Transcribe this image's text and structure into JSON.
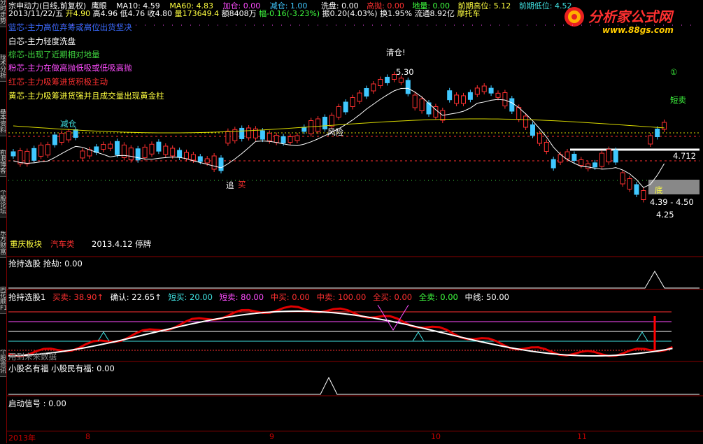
{
  "header": {
    "stock_name": "宗申动力(日线,前复权)",
    "indicator_name": "鹰眼",
    "ma10": "MA10: 4.59",
    "ma60": "MA60: 4.83",
    "jiacang": "加仓: 0.00",
    "jiancang": "减仓: 1.00",
    "xipan": "洗盘: 0.00",
    "gaopao": "高抛: 0.00",
    "diliang": "地量: 0.00",
    "prev_high": "前期高位: 5.12",
    "prev_low": "前期低位: 4.52",
    "date": "2013/11/22/五",
    "open": "开4.90",
    "high": "高4.96",
    "low": "低4.76",
    "close": "收4.80",
    "volume": "量173649.4",
    "amount": "额8408万",
    "change": "幅-0.16(-3.23%)",
    "amplitude": "振0.20(4.03%)",
    "turnover": "换1.95%",
    "float_shares": "流通8.92亿",
    "sector": "摩托车"
  },
  "left_tabs": [
    "分时走势",
    "技术分析",
    "基本资料",
    "新浪博客",
    "个股论坛",
    "东方财富",
    "同花顺F10",
    "个股资讯"
  ],
  "legend": [
    {
      "text": "蓝芯-主力高位弃筹或高位出货坚决",
      "color": "#3a6bff"
    },
    {
      "text": "白芯-主力轻度洗盘",
      "color": "#ffffff"
    },
    {
      "text": "棕芯-出现了近期相对地量",
      "color": "#3fd63f"
    },
    {
      "text": "粉芯-主力在做高抛低吸或低吸高抛",
      "color": "#ff4dff"
    },
    {
      "text": "红芯-主力吸筹进货积极主动",
      "color": "#ff3030"
    },
    {
      "text": "黄芯-主力吸筹进货强并且成交量出现黄金柱",
      "color": "#ffff40"
    }
  ],
  "annotations": {
    "qingcang": "清仓!",
    "peak_price": "5.30",
    "circle1": "①",
    "duanmai": "短卖",
    "jiancang_lbl": "减仓",
    "fengxian": "风险",
    "zhui": "追",
    "mai": "买",
    "level": "4.712",
    "di": "底",
    "range": "4.39 - 4.50",
    "bottom_price": "4.25",
    "sector_block": "重庆板块",
    "sector_cat": "汽车类",
    "suspend": "2013.4.12 停牌"
  },
  "panels": {
    "p2_title": "抢持选股 抢劫: 0.00",
    "p3_title": "抢持选股1",
    "p3_values": [
      {
        "text": "买卖: 38.90↑",
        "color": "#ff3030"
      },
      {
        "text": "确认: 22.65↑",
        "color": "#ffffff"
      },
      {
        "text": "短买: 20.00",
        "color": "#40e0e0"
      },
      {
        "text": "短卖: 80.00",
        "color": "#ff4dff"
      },
      {
        "text": "中买: 0.00",
        "color": "#ff3030"
      },
      {
        "text": "中卖: 100.00",
        "color": "#ff3030"
      },
      {
        "text": "全买: 0.00",
        "color": "#ff3030"
      },
      {
        "text": "全卖: 0.00",
        "color": "#40ff40"
      },
      {
        "text": "中线: 50.00",
        "color": "#ffffff"
      }
    ],
    "p3_note": "用到未来数据",
    "p4_title": "小股名有福 小股民有福: 0.00",
    "p5_title": "启动信号 : 0.00"
  },
  "date_axis": [
    "2013年",
    "8",
    "9",
    "10",
    "11"
  ],
  "logo": {
    "text": "分析家公式网",
    "url_text": "www.88gs.com"
  },
  "colors": {
    "up": "#ff3030",
    "down": "#40c8ff",
    "ma_white": "#ffffff",
    "ma_yellow": "#d8d800",
    "separator": "#8a0000"
  }
}
